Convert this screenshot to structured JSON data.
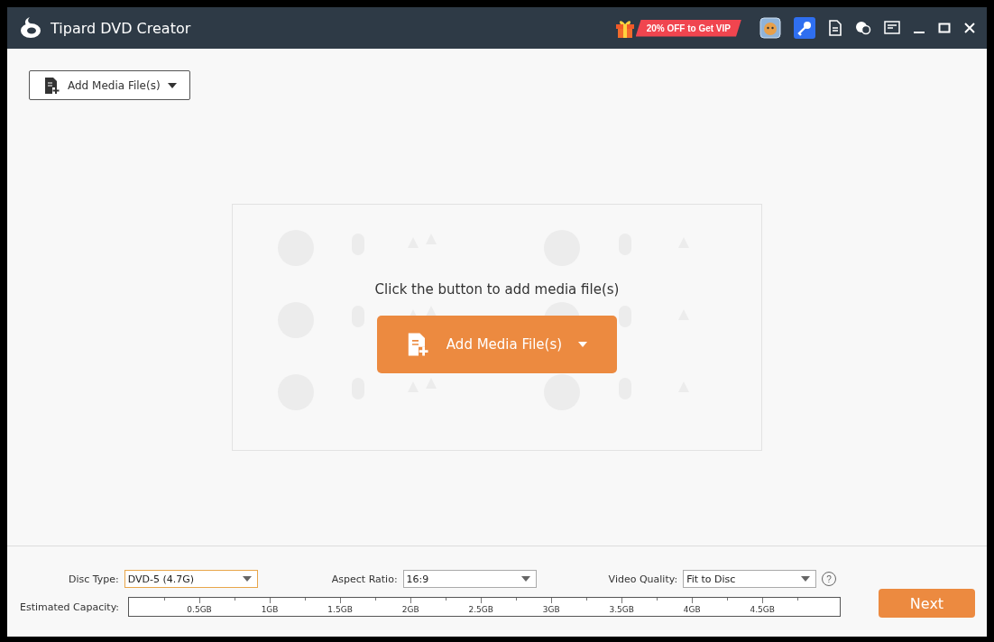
{
  "window": {
    "title": "Tipard DVD Creator"
  },
  "promo": {
    "label": "20% OFF to Get VIP"
  },
  "toolbar": {
    "add_button": "Add Media File(s)"
  },
  "empty_state": {
    "message": "Click the button to add media file(s)",
    "button": "Add Media File(s)"
  },
  "settings": [
    {
      "label": "Disc Type:",
      "value": "DVD-5 (4.7G)",
      "focused": true
    },
    {
      "label": "Aspect Ratio:",
      "value": "16:9",
      "focused": false
    },
    {
      "label": "Video Quality:",
      "value": "Fit to Disc",
      "focused": false
    }
  ],
  "help": {
    "label": "?"
  },
  "capacity": {
    "label": "Estimated Capacity:",
    "ticks": [
      "0.5GB",
      "1GB",
      "1.5GB",
      "2GB",
      "2.5GB",
      "3GB",
      "3.5GB",
      "4GB",
      "4.5GB"
    ]
  },
  "next_button": "Next"
}
